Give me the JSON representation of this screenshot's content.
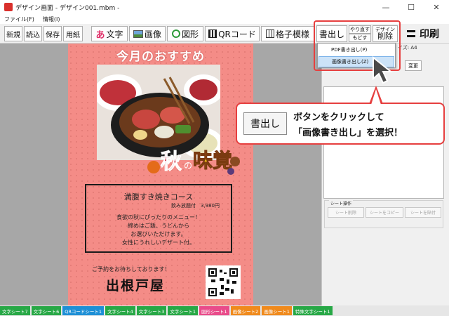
{
  "window": {
    "title": "デザイン画面 - デザイン001.mbm -",
    "minimize": "—",
    "maximize": "☐",
    "close": "✕"
  },
  "menu": {
    "items": [
      "ファイル(F)",
      "情報(I)"
    ]
  },
  "toolbar": {
    "new": "新規",
    "open": "読込",
    "save": "保存",
    "paper": "用紙",
    "text": "文字",
    "image": "画像",
    "shape": "図形",
    "qr": "QRコード",
    "grid": "格子模様",
    "export": "書出し",
    "redo": "やり直す",
    "undo": "もどす",
    "design_top": "デザイン",
    "design_delete": "削除",
    "print": "印刷"
  },
  "dropdown": {
    "items": [
      "PDF書き出し(P)",
      "画像書き出し(Z)"
    ],
    "selected_index": 1
  },
  "right_panel": {
    "size_label": "イズ: A4",
    "change_button": "変更",
    "sheet_ops_legend": "シート操作",
    "sheet_buttons": [
      "シート削除",
      "シートをコピー",
      "シートを貼付"
    ]
  },
  "callout": {
    "button_text": "書出し",
    "line1": "ボタンをクリックして",
    "line2": "「画像書き出し」を選択！"
  },
  "canvas": {
    "title": "今月のおすすめ",
    "logo_text_1": "秋",
    "logo_text_2": "の",
    "logo_text_3": "味覚",
    "course_title": "満腹すき焼きコース",
    "price": "飲み放題付　3,980円",
    "lines": [
      "食欲の秋にぴったりのメニュー！",
      "締めはご飯、うどんから",
      "お選びいただけます。",
      "女性にうれしいデザート付。"
    ],
    "reserve": "ご予約をお待ちしております！",
    "shop": "出根戸屋"
  },
  "tabs": [
    {
      "label": "文字シート7",
      "color": "#27a846"
    },
    {
      "label": "文字シート6",
      "color": "#27a846"
    },
    {
      "label": "QRコードシート1",
      "color": "#1d8fd6"
    },
    {
      "label": "文字シート4",
      "color": "#27a846"
    },
    {
      "label": "文字シート3",
      "color": "#27a846"
    },
    {
      "label": "文字シート1",
      "color": "#27a846"
    },
    {
      "label": "図形シート1",
      "color": "#e94b8a"
    },
    {
      "label": "画像シート2",
      "color": "#f08a1c"
    },
    {
      "label": "画像シート1",
      "color": "#f08a1c"
    },
    {
      "label": "特殊文字シート1",
      "color": "#27a846"
    }
  ]
}
